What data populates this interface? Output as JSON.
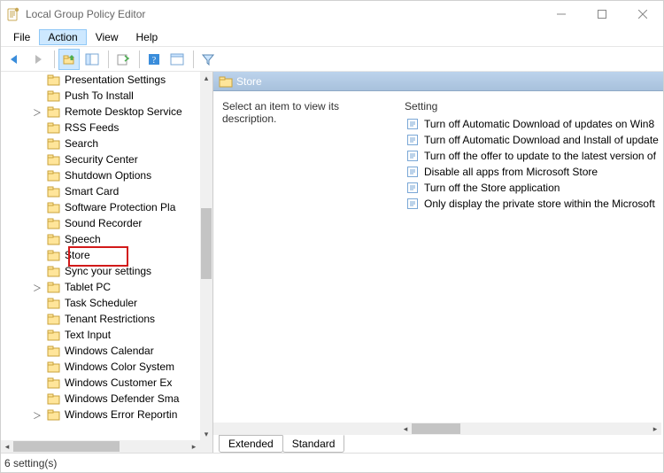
{
  "title": "Local Group Policy Editor",
  "menu": {
    "file": "File",
    "action": "Action",
    "view": "View",
    "help": "Help"
  },
  "tree": {
    "items": [
      {
        "label": "Presentation Settings",
        "expandable": false
      },
      {
        "label": "Push To Install",
        "expandable": false
      },
      {
        "label": "Remote Desktop Service",
        "expandable": true
      },
      {
        "label": "RSS Feeds",
        "expandable": false
      },
      {
        "label": "Search",
        "expandable": false
      },
      {
        "label": "Security Center",
        "expandable": false
      },
      {
        "label": "Shutdown Options",
        "expandable": false
      },
      {
        "label": "Smart Card",
        "expandable": false
      },
      {
        "label": "Software Protection Pla",
        "expandable": false
      },
      {
        "label": "Sound Recorder",
        "expandable": false
      },
      {
        "label": "Speech",
        "expandable": false
      },
      {
        "label": "Store",
        "expandable": false,
        "highlighted": true
      },
      {
        "label": "Sync your settings",
        "expandable": false
      },
      {
        "label": "Tablet PC",
        "expandable": true
      },
      {
        "label": "Task Scheduler",
        "expandable": false
      },
      {
        "label": "Tenant Restrictions",
        "expandable": false
      },
      {
        "label": "Text Input",
        "expandable": false
      },
      {
        "label": "Windows Calendar",
        "expandable": false
      },
      {
        "label": "Windows Color System",
        "expandable": false
      },
      {
        "label": "Windows Customer Ex",
        "expandable": false
      },
      {
        "label": "Windows Defender Sma",
        "expandable": false
      },
      {
        "label": "Windows Error Reportin",
        "expandable": true
      }
    ]
  },
  "details": {
    "header": "Store",
    "description": "Select an item to view its description.",
    "setting_col": "Setting",
    "settings": [
      "Turn off Automatic Download of updates on Win8",
      "Turn off Automatic Download and Install of update",
      "Turn off the offer to update to the latest version of",
      "Disable all apps from Microsoft Store",
      "Turn off the Store application",
      "Only display the private store within the Microsoft"
    ],
    "tabs": {
      "extended": "Extended",
      "standard": "Standard"
    }
  },
  "status": "6 setting(s)"
}
